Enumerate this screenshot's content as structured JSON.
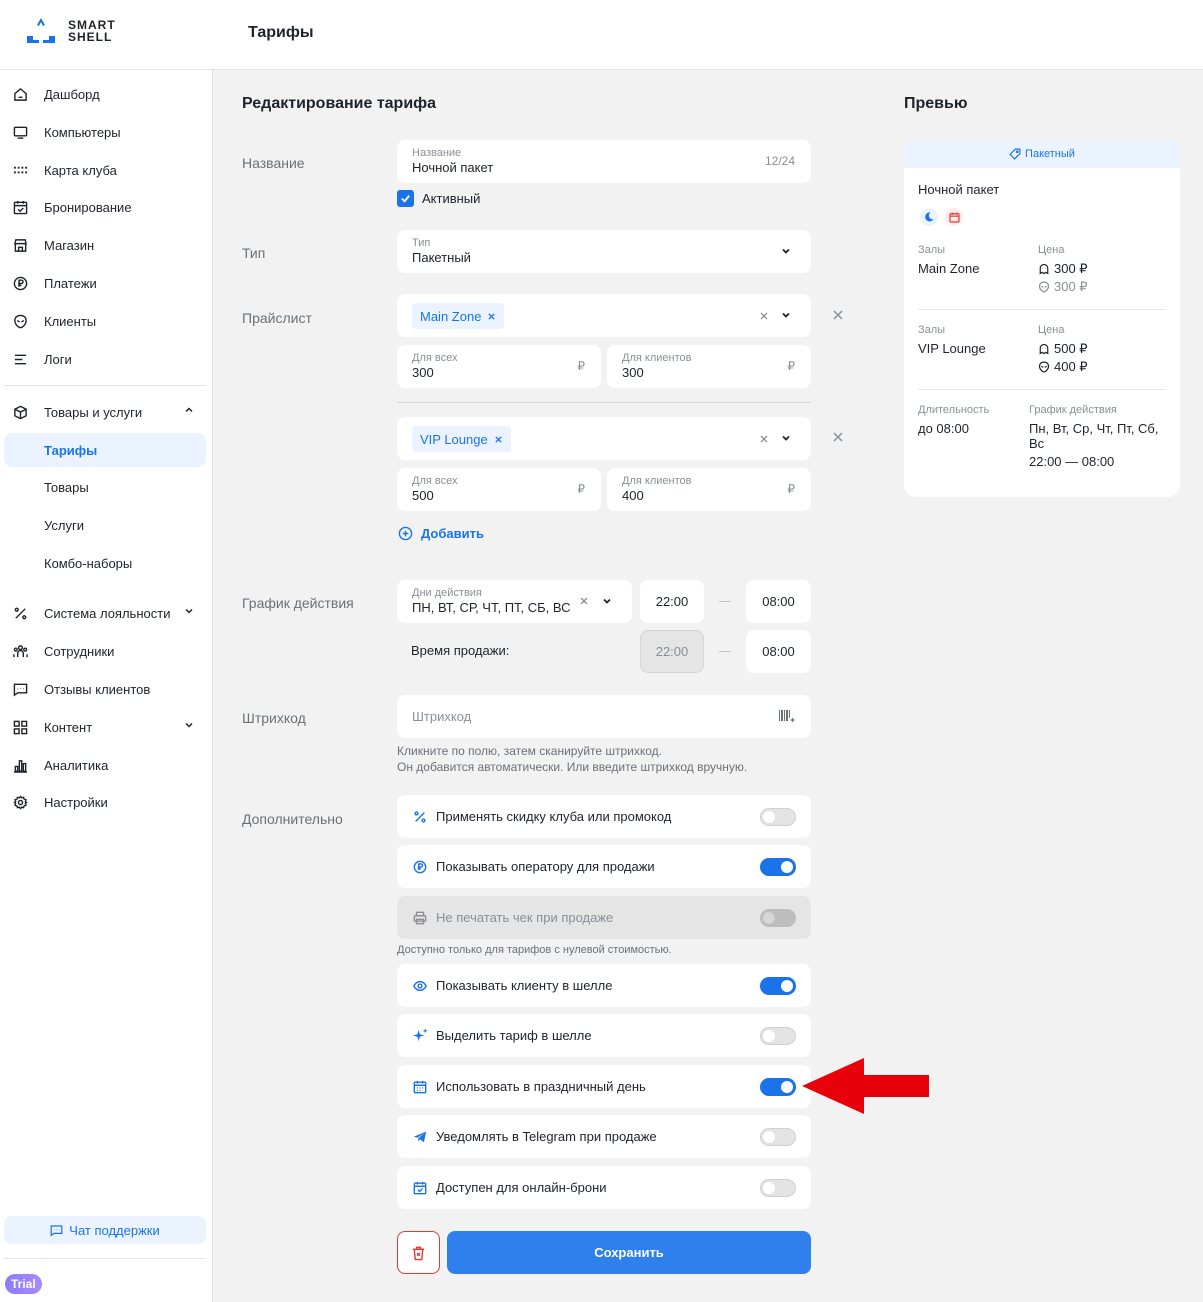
{
  "app": {
    "logo_line1": "SMART",
    "logo_line2": "SHELL",
    "page_title": "Тарифы"
  },
  "sidebar": {
    "items": [
      {
        "label": "Дашборд",
        "icon": "home-icon"
      },
      {
        "label": "Компьютеры",
        "icon": "monitor-icon"
      },
      {
        "label": "Карта клуба",
        "icon": "grid-dots-icon"
      },
      {
        "label": "Бронирование",
        "icon": "calendar-check-icon"
      },
      {
        "label": "Магазин",
        "icon": "store-icon"
      },
      {
        "label": "Платежи",
        "icon": "ruble-circle-icon"
      },
      {
        "label": "Клиенты",
        "icon": "alien-icon"
      },
      {
        "label": "Логи",
        "icon": "list-icon"
      },
      {
        "label": "Товары и услуги",
        "icon": "box-icon"
      },
      {
        "label": "Тарифы"
      },
      {
        "label": "Товары"
      },
      {
        "label": "Услуги"
      },
      {
        "label": "Комбо-наборы"
      },
      {
        "label": "Система лояльности",
        "icon": "percent-icon"
      },
      {
        "label": "Сотрудники",
        "icon": "team-icon"
      },
      {
        "label": "Отзывы клиентов",
        "icon": "chat-icon"
      },
      {
        "label": "Контент",
        "icon": "grid-icon"
      },
      {
        "label": "Аналитика",
        "icon": "bar-chart-icon"
      },
      {
        "label": "Настройки",
        "icon": "gear-icon"
      }
    ],
    "support_label": "Чат поддержки",
    "trial_label": "Trial"
  },
  "editor": {
    "title": "Редактирование тарифа",
    "labels": {
      "name": "Название",
      "type": "Тип",
      "pricelist": "Прайслист",
      "schedule": "График действия",
      "barcode": "Штрихкод",
      "extra": "Дополнительно"
    },
    "name_field": {
      "label": "Название",
      "value": "Ночной пакет",
      "counter": "12/24"
    },
    "active": {
      "label": "Активный",
      "checked": true
    },
    "type_field": {
      "label": "Тип",
      "value": "Пакетный"
    },
    "pricelists": [
      {
        "zone": "Main Zone",
        "all_label": "Для всех",
        "all_value": "300",
        "clients_label": "Для клиентов",
        "clients_value": "300",
        "currency": "₽"
      },
      {
        "zone": "VIP Lounge",
        "all_label": "Для всех",
        "all_value": "500",
        "clients_label": "Для клиентов",
        "clients_value": "400",
        "currency": "₽"
      }
    ],
    "add_label": "Добавить",
    "days_field": {
      "label": "Дни действия",
      "value": "ПН, ВТ, СР, ЧТ, ПТ, СБ, ВС"
    },
    "time_from": "22:00",
    "time_to": "08:00",
    "sale_time_label": "Время продажи:",
    "sale_time_from": "22:00",
    "sale_time_to": "08:00",
    "barcode_placeholder": "Штрихкод",
    "barcode_hint_1": "Кликните по полю, затем сканируйте штрихкод.",
    "barcode_hint_2": "Он добавится автоматически. Или введите штрихкод вручную.",
    "toggles": [
      {
        "label": "Применять скидку клуба или промокод",
        "on": false,
        "icon": "percent-icon"
      },
      {
        "label": "Показывать оператору для продажи",
        "on": true,
        "icon": "ruble-circle-icon"
      },
      {
        "label": "Не печатать чек при продаже",
        "on": false,
        "disabled": true,
        "icon": "printer-icon"
      },
      {
        "label": "Показывать клиенту в шелле",
        "on": true,
        "icon": "eye-icon"
      },
      {
        "label": "Выделить тариф в шелле",
        "on": false,
        "icon": "sparkle-icon"
      },
      {
        "label": "Использовать в праздничный день",
        "on": true,
        "icon": "calendar-icon"
      },
      {
        "label": "Уведомлять в Telegram при продаже",
        "on": false,
        "icon": "telegram-icon"
      },
      {
        "label": "Доступен для онлайн-брони",
        "on": false,
        "icon": "calendar-check-icon"
      }
    ],
    "zero_cost_hint": "Доступно только для тарифов с нулевой стоимостью.",
    "save_label": "Сохранить"
  },
  "preview": {
    "title": "Превью",
    "badge": "Пакетный",
    "name": "Ночной пакет",
    "halls_label": "Залы",
    "price_label": "Цена",
    "rows": [
      {
        "hall": "Main Zone",
        "price_all": "300 ₽",
        "price_clients": "300 ₽"
      },
      {
        "hall": "VIP Lounge",
        "price_all": "500 ₽",
        "price_clients": "400 ₽"
      }
    ],
    "duration_label": "Длительность",
    "duration_value": "до 08:00",
    "schedule_label": "График действия",
    "schedule_days": "Пн, Вт, Ср, Чт, Пт, Сб, Вс",
    "schedule_time": "22:00 — 08:00"
  },
  "colors": {
    "accent": "#1a73e8",
    "danger": "#e53935",
    "arrow": "#e8000b"
  }
}
